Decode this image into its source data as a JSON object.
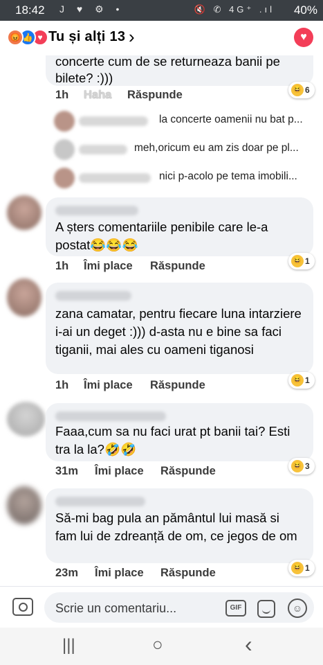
{
  "status_bar": {
    "time": "18:42",
    "left_icons": "J ♥ ⚙ •",
    "right_icons": "🔇 ✆ 4G⁺ .ıl",
    "battery": "40%"
  },
  "header": {
    "reaction_icons": [
      "angry-reaction-icon",
      "like-reaction-icon",
      "love-reaction-icon"
    ],
    "title": "Tu și alți 13",
    "chevron": "›"
  },
  "comments": [
    {
      "text_top": "concerte cum de se returneaza banii pe",
      "text": "bilete? :)))",
      "time": "1h",
      "like_label": "Haha",
      "reply_label": "Răspunde",
      "reaction_count": "6"
    },
    {
      "text": "A șters comentariile penibile care le-a postat😂😂😂",
      "time": "1h",
      "like_label": "Îmi place",
      "reply_label": "Răspunde",
      "reaction_count": "1"
    },
    {
      "text": "zana camatar, pentru fiecare luna intarziere i-ai un deget :))) d-asta nu e bine sa faci tiganii, mai ales cu oameni tiganosi",
      "time": "1h",
      "like_label": "Îmi place",
      "reply_label": "Răspunde",
      "reaction_count": "1"
    },
    {
      "text": "Faaa,cum sa nu faci urat pt banii tai? Esti tra la la?🤣🤣",
      "time": "31m",
      "like_label": "Îmi place",
      "reply_label": "Răspunde",
      "reaction_count": "3"
    },
    {
      "text": "Să-mi bag pula an pământul lui masă si fam lui de zdreanță de om, ce jegos de om",
      "time": "23m",
      "like_label": "Îmi place",
      "reply_label": "Răspunde",
      "reaction_count": "1"
    }
  ],
  "replies": [
    {
      "text": "la concerte oamenii nu bat p..."
    },
    {
      "text": "meh,oricum eu am zis doar pe pl..."
    },
    {
      "text": "nici p-acolo pe tema imobili..."
    }
  ],
  "composer": {
    "placeholder": "Scrie un comentariu...",
    "gif_label": "GIF"
  },
  "nav": {
    "recents": "|||",
    "home": "○",
    "back": "‹"
  }
}
